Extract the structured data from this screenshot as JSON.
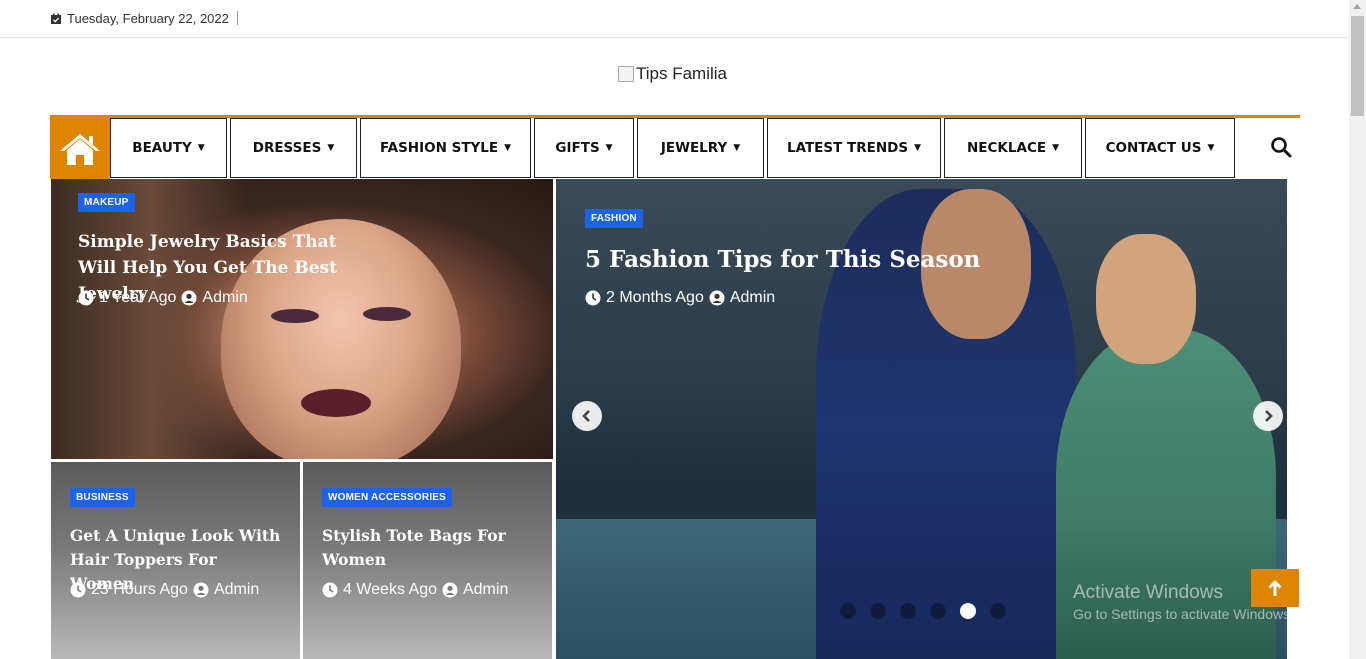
{
  "topbar": {
    "date": "Tuesday, February 22, 2022",
    "date_icon": "calendar-check-icon"
  },
  "logo": {
    "alt_text": "Tips Familia"
  },
  "nav": {
    "home_icon": "home-icon",
    "search_icon": "search-icon",
    "accent_color": "#dd8500",
    "items": [
      {
        "label": "BEAUTY",
        "has_dropdown": true
      },
      {
        "label": "DRESSES",
        "has_dropdown": true
      },
      {
        "label": "FASHION STYLE",
        "has_dropdown": true
      },
      {
        "label": "GIFTS",
        "has_dropdown": true
      },
      {
        "label": "JEWELRY",
        "has_dropdown": true
      },
      {
        "label": "LATEST TRENDS",
        "has_dropdown": true
      },
      {
        "label": "NECKLACE",
        "has_dropdown": true
      },
      {
        "label": "CONTACT US",
        "has_dropdown": true
      }
    ]
  },
  "posts": {
    "featured_left": {
      "category": "MAKEUP",
      "title": "Simple Jewelry Basics That Will Help You Get The Best Jewelry",
      "time": "1 Year Ago",
      "author": "Admin"
    },
    "slider": {
      "category": "FASHION",
      "title": "5 Fashion Tips for This Season",
      "time": "2 Months Ago",
      "author": "Admin",
      "dot_count": 6,
      "active_dot": 5
    },
    "bottom_left": {
      "category": "BUSINESS",
      "title": "Get A Unique Look With Hair Toppers For Women",
      "time": "23 Hours Ago",
      "author": "Admin"
    },
    "bottom_right": {
      "category": "WOMEN ACCESSORIES",
      "title": "Stylish Tote Bags For Women",
      "time": "4 Weeks Ago",
      "author": "Admin"
    }
  },
  "badge_color": "#1d62ea",
  "scroll_top_icon": "arrow-up-icon",
  "watermark": {
    "line1": "Activate Windows",
    "line2": "Go to Settings to activate Windows."
  }
}
